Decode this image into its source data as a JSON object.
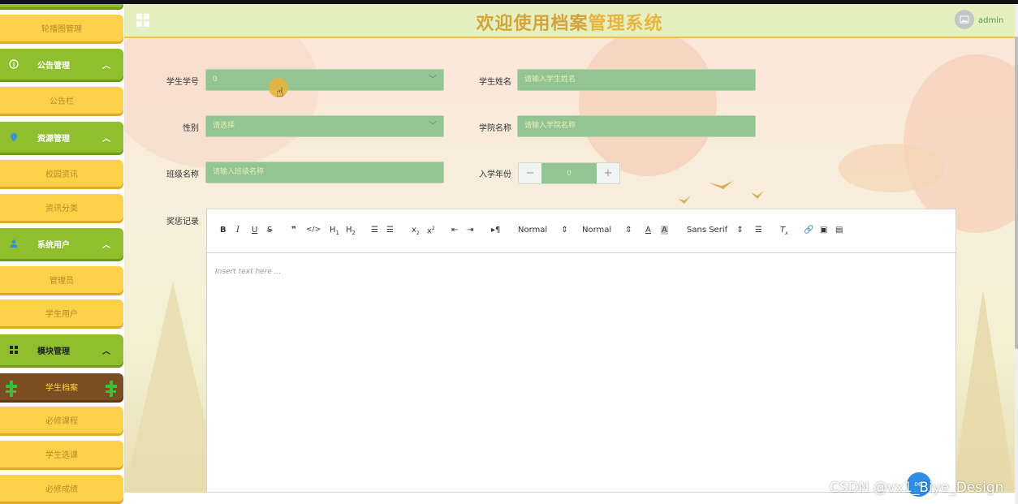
{
  "header": {
    "title_part1": "欢迎使用档案",
    "title_part2": "管理系统",
    "username": "admin"
  },
  "sidebar": {
    "items": [
      {
        "label": "轮播图管理",
        "type": "sub"
      },
      {
        "label": "公告管理",
        "type": "parent",
        "icon": "info-circle-icon"
      },
      {
        "label": "公告栏",
        "type": "sub"
      },
      {
        "label": "资源管理",
        "type": "parent",
        "icon": "location-pin-icon"
      },
      {
        "label": "校园资讯",
        "type": "sub"
      },
      {
        "label": "资讯分类",
        "type": "sub"
      },
      {
        "label": "系统用户",
        "type": "parent",
        "icon": "user-icon"
      },
      {
        "label": "管理员",
        "type": "sub"
      },
      {
        "label": "学生用户",
        "type": "sub"
      },
      {
        "label": "模块管理",
        "type": "parent",
        "icon": "grid-icon"
      },
      {
        "label": "学生档案",
        "type": "active"
      },
      {
        "label": "必修课程",
        "type": "sub"
      },
      {
        "label": "学生选课",
        "type": "sub"
      },
      {
        "label": "必修成绩",
        "type": "sub"
      }
    ]
  },
  "form": {
    "student_no_label": "学生学号",
    "student_no_value": "0",
    "student_name_label": "学生姓名",
    "student_name_placeholder": "请输入学生姓名",
    "gender_label": "性别",
    "gender_placeholder": "请选择",
    "college_label": "学院名称",
    "college_placeholder": "请输入学院名称",
    "class_label": "班级名称",
    "class_placeholder": "请输入班级名称",
    "year_label": "入学年份",
    "year_value": "0",
    "award_label": "奖惩记录"
  },
  "editor": {
    "placeholder": "Insert text here ...",
    "header_select": "Normal",
    "size_select": "Normal",
    "font_select": "Sans Serif"
  },
  "float_button": "06:",
  "watermark": "CSDN @vx1_Biye_Design",
  "colors": {
    "sidebar_sub": "#ffd04a",
    "sidebar_parent": "#8fbf2c",
    "sidebar_active": "#7a4e22",
    "input_bg": "#93c493",
    "header_bg": "#e6efbf"
  }
}
